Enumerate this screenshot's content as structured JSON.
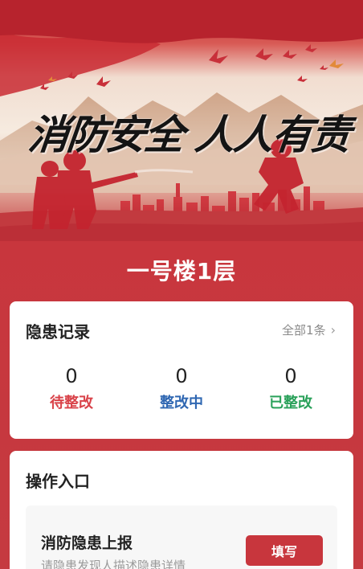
{
  "banner": {
    "slogan": "消防安全 人人有责"
  },
  "location": {
    "title": "一号楼1层"
  },
  "records": {
    "title": "隐患记录",
    "view_all": "全部1条",
    "stats": [
      {
        "value": "0",
        "label": "待整改"
      },
      {
        "value": "0",
        "label": "整改中"
      },
      {
        "value": "0",
        "label": "已整改"
      }
    ]
  },
  "actions": {
    "title": "操作入口",
    "items": [
      {
        "name": "消防隐患上报",
        "description": "请隐患发现人描述隐患详情",
        "button_label": "填写"
      }
    ]
  },
  "colors": {
    "primary_red": "#c8363d",
    "pending": "#d9434a",
    "in_progress": "#2f67b2",
    "done": "#2aa15a"
  }
}
